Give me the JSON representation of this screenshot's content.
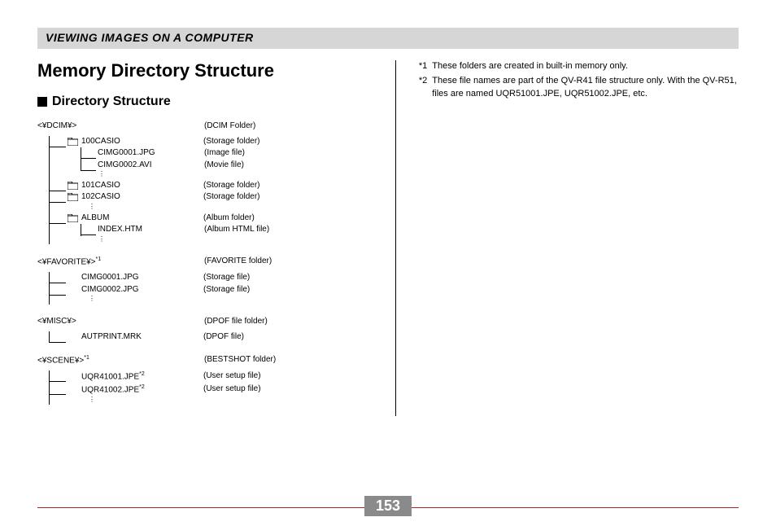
{
  "header": "VIEWING IMAGES ON A COMPUTER",
  "title": "Memory Directory Structure",
  "subtitle": "Directory Structure",
  "pageNumber": "153",
  "notes": [
    {
      "num": "*1",
      "text": "These folders are created in built-in memory only."
    },
    {
      "num": "*2",
      "text": "These file names are part of the QV-R41 file structure only. With the QV-R51, files are named UQR51001.JPE, UQR51002.JPE, etc."
    }
  ],
  "sections": [
    {
      "root": "<¥DCIM¥>",
      "rootSup": "",
      "rootDesc": "(DCIM Folder)",
      "children": [
        {
          "icon": true,
          "label": "100CASIO",
          "desc": "(Storage folder)",
          "sub": [
            {
              "label": "CIMG0001.JPG",
              "desc": "(Image file)"
            },
            {
              "label": "CIMG0002.AVI",
              "desc": "(Movie file)"
            }
          ],
          "dotsAfter": true
        },
        {
          "icon": true,
          "label": "101CASIO",
          "desc": "(Storage folder)"
        },
        {
          "icon": true,
          "label": "102CASIO",
          "desc": "(Storage folder)",
          "dotsAfter": true
        },
        {
          "icon": true,
          "label": "ALBUM",
          "desc": "(Album folder)",
          "sub": [
            {
              "label": "INDEX.HTM",
              "desc": "(Album HTML file)"
            }
          ],
          "dotsAfter": true
        }
      ]
    },
    {
      "root": "<¥FAVORITE¥>",
      "rootSup": "*1",
      "rootDesc": "(FAVORITE folder)",
      "children": [
        {
          "icon": false,
          "label": "CIMG0001.JPG",
          "desc": "(Storage file)"
        },
        {
          "icon": false,
          "label": "CIMG0002.JPG",
          "desc": "(Storage file)",
          "dotsAfter": true
        }
      ]
    },
    {
      "root": "<¥MISC¥>",
      "rootSup": "",
      "rootDesc": "(DPOF file folder)",
      "children": [
        {
          "icon": false,
          "label": "AUTPRINT.MRK",
          "desc": "(DPOF file)"
        }
      ]
    },
    {
      "root": "<¥SCENE¥>",
      "rootSup": "*1",
      "rootDesc": "(BESTSHOT folder)",
      "children": [
        {
          "icon": false,
          "label": "UQR41001.JPE",
          "sup": "*2",
          "desc": "(User setup file)"
        },
        {
          "icon": false,
          "label": "UQR41002.JPE",
          "sup": "*2",
          "desc": "(User setup file)",
          "dotsAfter": true
        }
      ]
    }
  ]
}
